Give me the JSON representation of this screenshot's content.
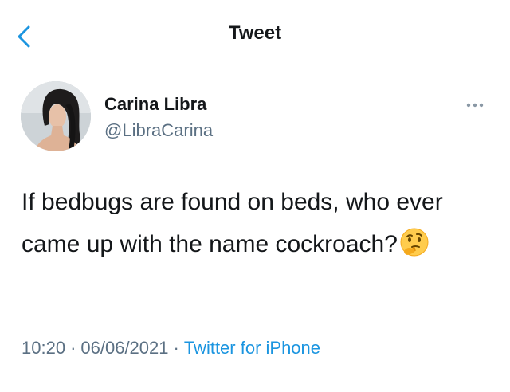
{
  "header": {
    "title": "Tweet",
    "back_icon": "chevron-left-icon"
  },
  "author": {
    "name": "Carina Libra",
    "handle": "@LibraCarina",
    "more_icon": "more-horizontal-icon"
  },
  "tweet": {
    "text": "If bedbugs are found on beds, who ever came up with the name cockroach?",
    "emoji": "thinking-face-icon"
  },
  "meta": {
    "time": "10:20",
    "separator": "·",
    "date": "06/06/2021",
    "source": "Twitter for iPhone"
  },
  "colors": {
    "accent": "#1b95e0",
    "text_primary": "#14171a",
    "text_secondary": "#5b7083",
    "divider": "#e3e6e8"
  }
}
